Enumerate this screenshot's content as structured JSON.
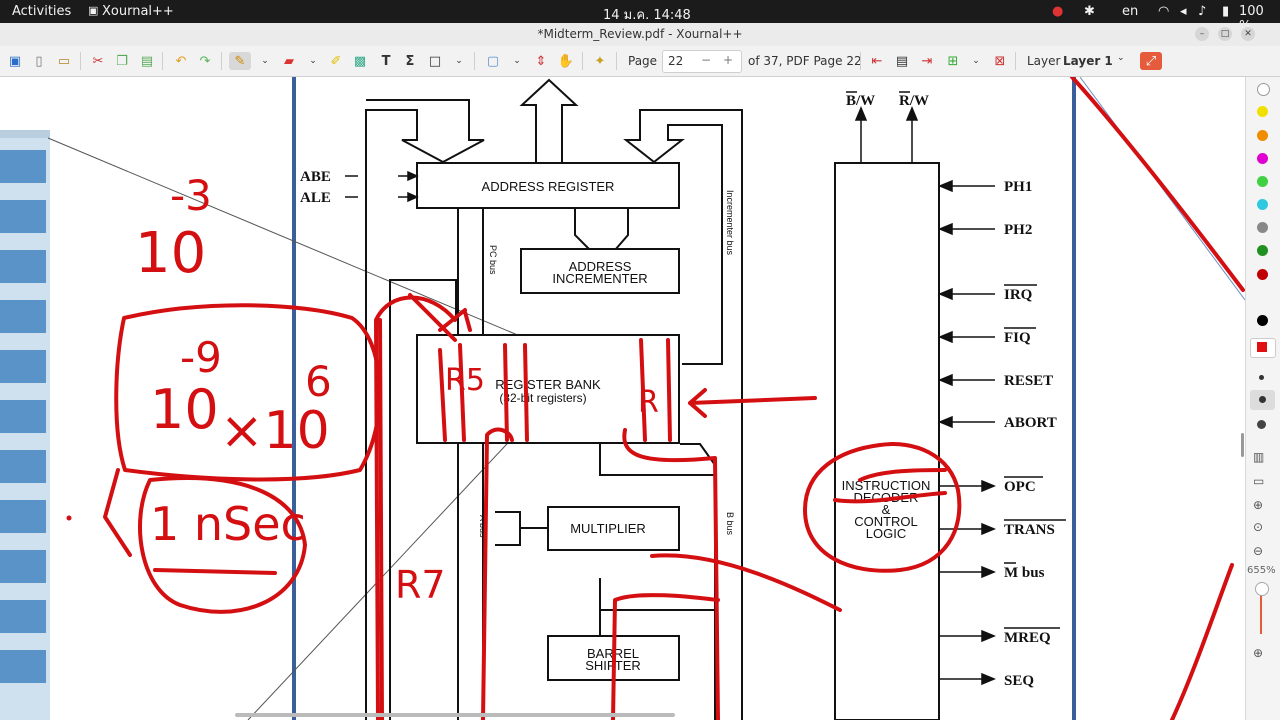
{
  "topbar": {
    "activities": "Activities",
    "app_name": "Xournal++",
    "datetime": "14 ม.ค.  14:48",
    "lang": "en",
    "battery": "100 %"
  },
  "window": {
    "title": "*Midterm_Review.pdf - Xournal++"
  },
  "toolbar": {
    "page_label": "Page",
    "page_value": "22",
    "minus": "−",
    "plus": "+",
    "page_info": "of 37, PDF Page 22",
    "layer_label": "Layer",
    "layer_value": "Layer 1"
  },
  "diagram": {
    "address_register": "ADDRESS REGISTER",
    "address_incrementer_1": "ADDRESS",
    "address_incrementer_2": "INCREMENTER",
    "register_bank_1": "REGISTER BANK",
    "register_bank_2": "(32-bit registers)",
    "multiplier": "MULTIPLIER",
    "barrel_1": "BARREL",
    "barrel_2": "SHIFTER",
    "instr_1": "INSTRUCTION",
    "instr_2": "DECODER",
    "instr_3": "&",
    "instr_4": "CONTROL",
    "instr_5": "LOGIC",
    "abe": "ABE",
    "ale": "ALE",
    "pc_bus": "PC bus",
    "incrementer_bus": "Incrementer bus",
    "a_bus": "A bus",
    "b_bus": "B bus",
    "bw": "B/W",
    "rw": "R/W",
    "signals_in": [
      "PH1",
      "PH2",
      "IRQ",
      "FIQ",
      "RESET",
      "ABORT"
    ],
    "signals_out": [
      "OPC",
      "TRANS",
      "M bus",
      "MREQ",
      "SEQ"
    ]
  },
  "annotations": {
    "ten_cubed_base": "10",
    "ten_cubed_exp": "-3",
    "exp_minus9": "-9",
    "ten_a": "10",
    "times_ten": "×10",
    "exp_6": "6",
    "one_nsec": "1 nSec",
    "r5": "R5",
    "r7": "R7",
    "r": "R"
  },
  "side": {
    "zoom": "655%"
  },
  "colors": {
    "ink_red": "#d40f12",
    "page_blue": "#3b5f9b",
    "black": "#111111"
  },
  "palette_colors": [
    "#ffffff",
    "#f0e000",
    "#f08c00",
    "#e000d0",
    "#40d040",
    "#30c8e0",
    "#888888",
    "#209020",
    "#c00000",
    "#000000",
    "#e01010"
  ]
}
